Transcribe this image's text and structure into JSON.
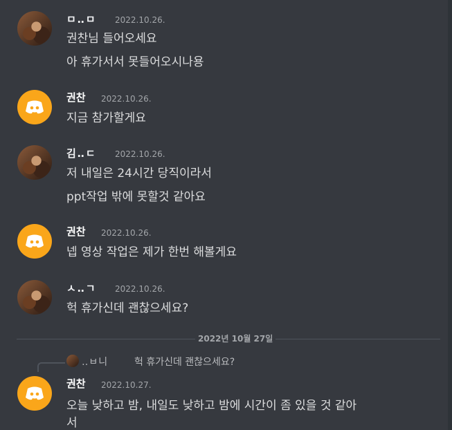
{
  "messages": [
    {
      "username": "ㅁ‥ㅁ",
      "timestamp": "2022.10.26.",
      "avatar": "photo",
      "lines": [
        "권찬님 들어오세요",
        "아 휴가서서 못들어오시나용"
      ]
    },
    {
      "username": "권찬",
      "timestamp": "2022.10.26.",
      "avatar": "discord",
      "lines": [
        "지금 참가할게요"
      ]
    },
    {
      "username": "김‥ㄷ",
      "timestamp": "2022.10.26.",
      "avatar": "photo",
      "lines": [
        "저 내일은 24시간 당직이라서",
        "ppt작업 밖에 못할것 같아요"
      ]
    },
    {
      "username": "권찬",
      "timestamp": "2022.10.26.",
      "avatar": "discord",
      "lines": [
        "넵 영상 작업은 제가 한번 해볼게요"
      ]
    },
    {
      "username": "ㅅ‥ㄱ",
      "timestamp": "2022.10.26.",
      "avatar": "photo",
      "lines": [
        "헉 휴가신데 괜찮으세요?"
      ]
    }
  ],
  "date_divider": "2022년 10월 27일",
  "reply": {
    "username": "‥ㅂ니",
    "text": "헉 휴가신데 괜찮으세요?",
    "message": {
      "username": "권찬",
      "timestamp": "2022.10.27.",
      "lines": [
        "오늘 낮하고 밤, 내일도 낮하고 밤에 시간이 좀 있을 것 같아",
        "서"
      ]
    }
  },
  "colors": {
    "background": "#36393f",
    "discord_avatar": "#faa61a",
    "timestamp": "#a3a6aa"
  },
  "icons": {
    "discord_avatar": "discord-logo-icon"
  }
}
